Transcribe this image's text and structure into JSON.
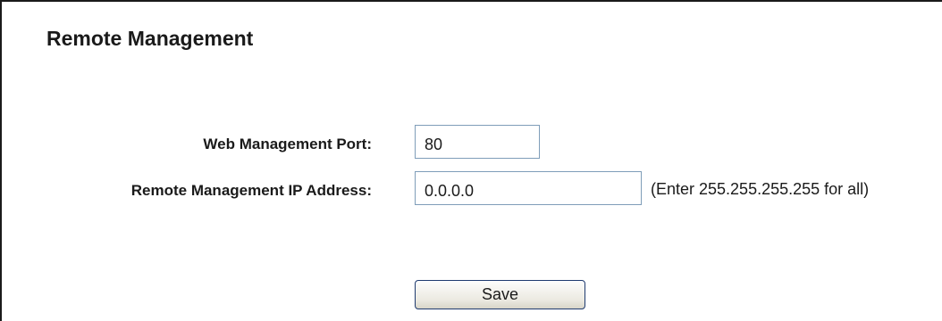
{
  "page": {
    "title": "Remote Management"
  },
  "form": {
    "web_port": {
      "label": "Web Management Port:",
      "value": "80"
    },
    "remote_ip": {
      "label": "Remote Management IP Address:",
      "value": "0.0.0.0",
      "hint": "(Enter 255.255.255.255 for all)"
    }
  },
  "actions": {
    "save_label": "Save"
  },
  "colors": {
    "text": "#1a1a1a",
    "input_border": "#7f9db9",
    "button_border": "#1f3b70",
    "frame_border": "#1a1a1a"
  }
}
